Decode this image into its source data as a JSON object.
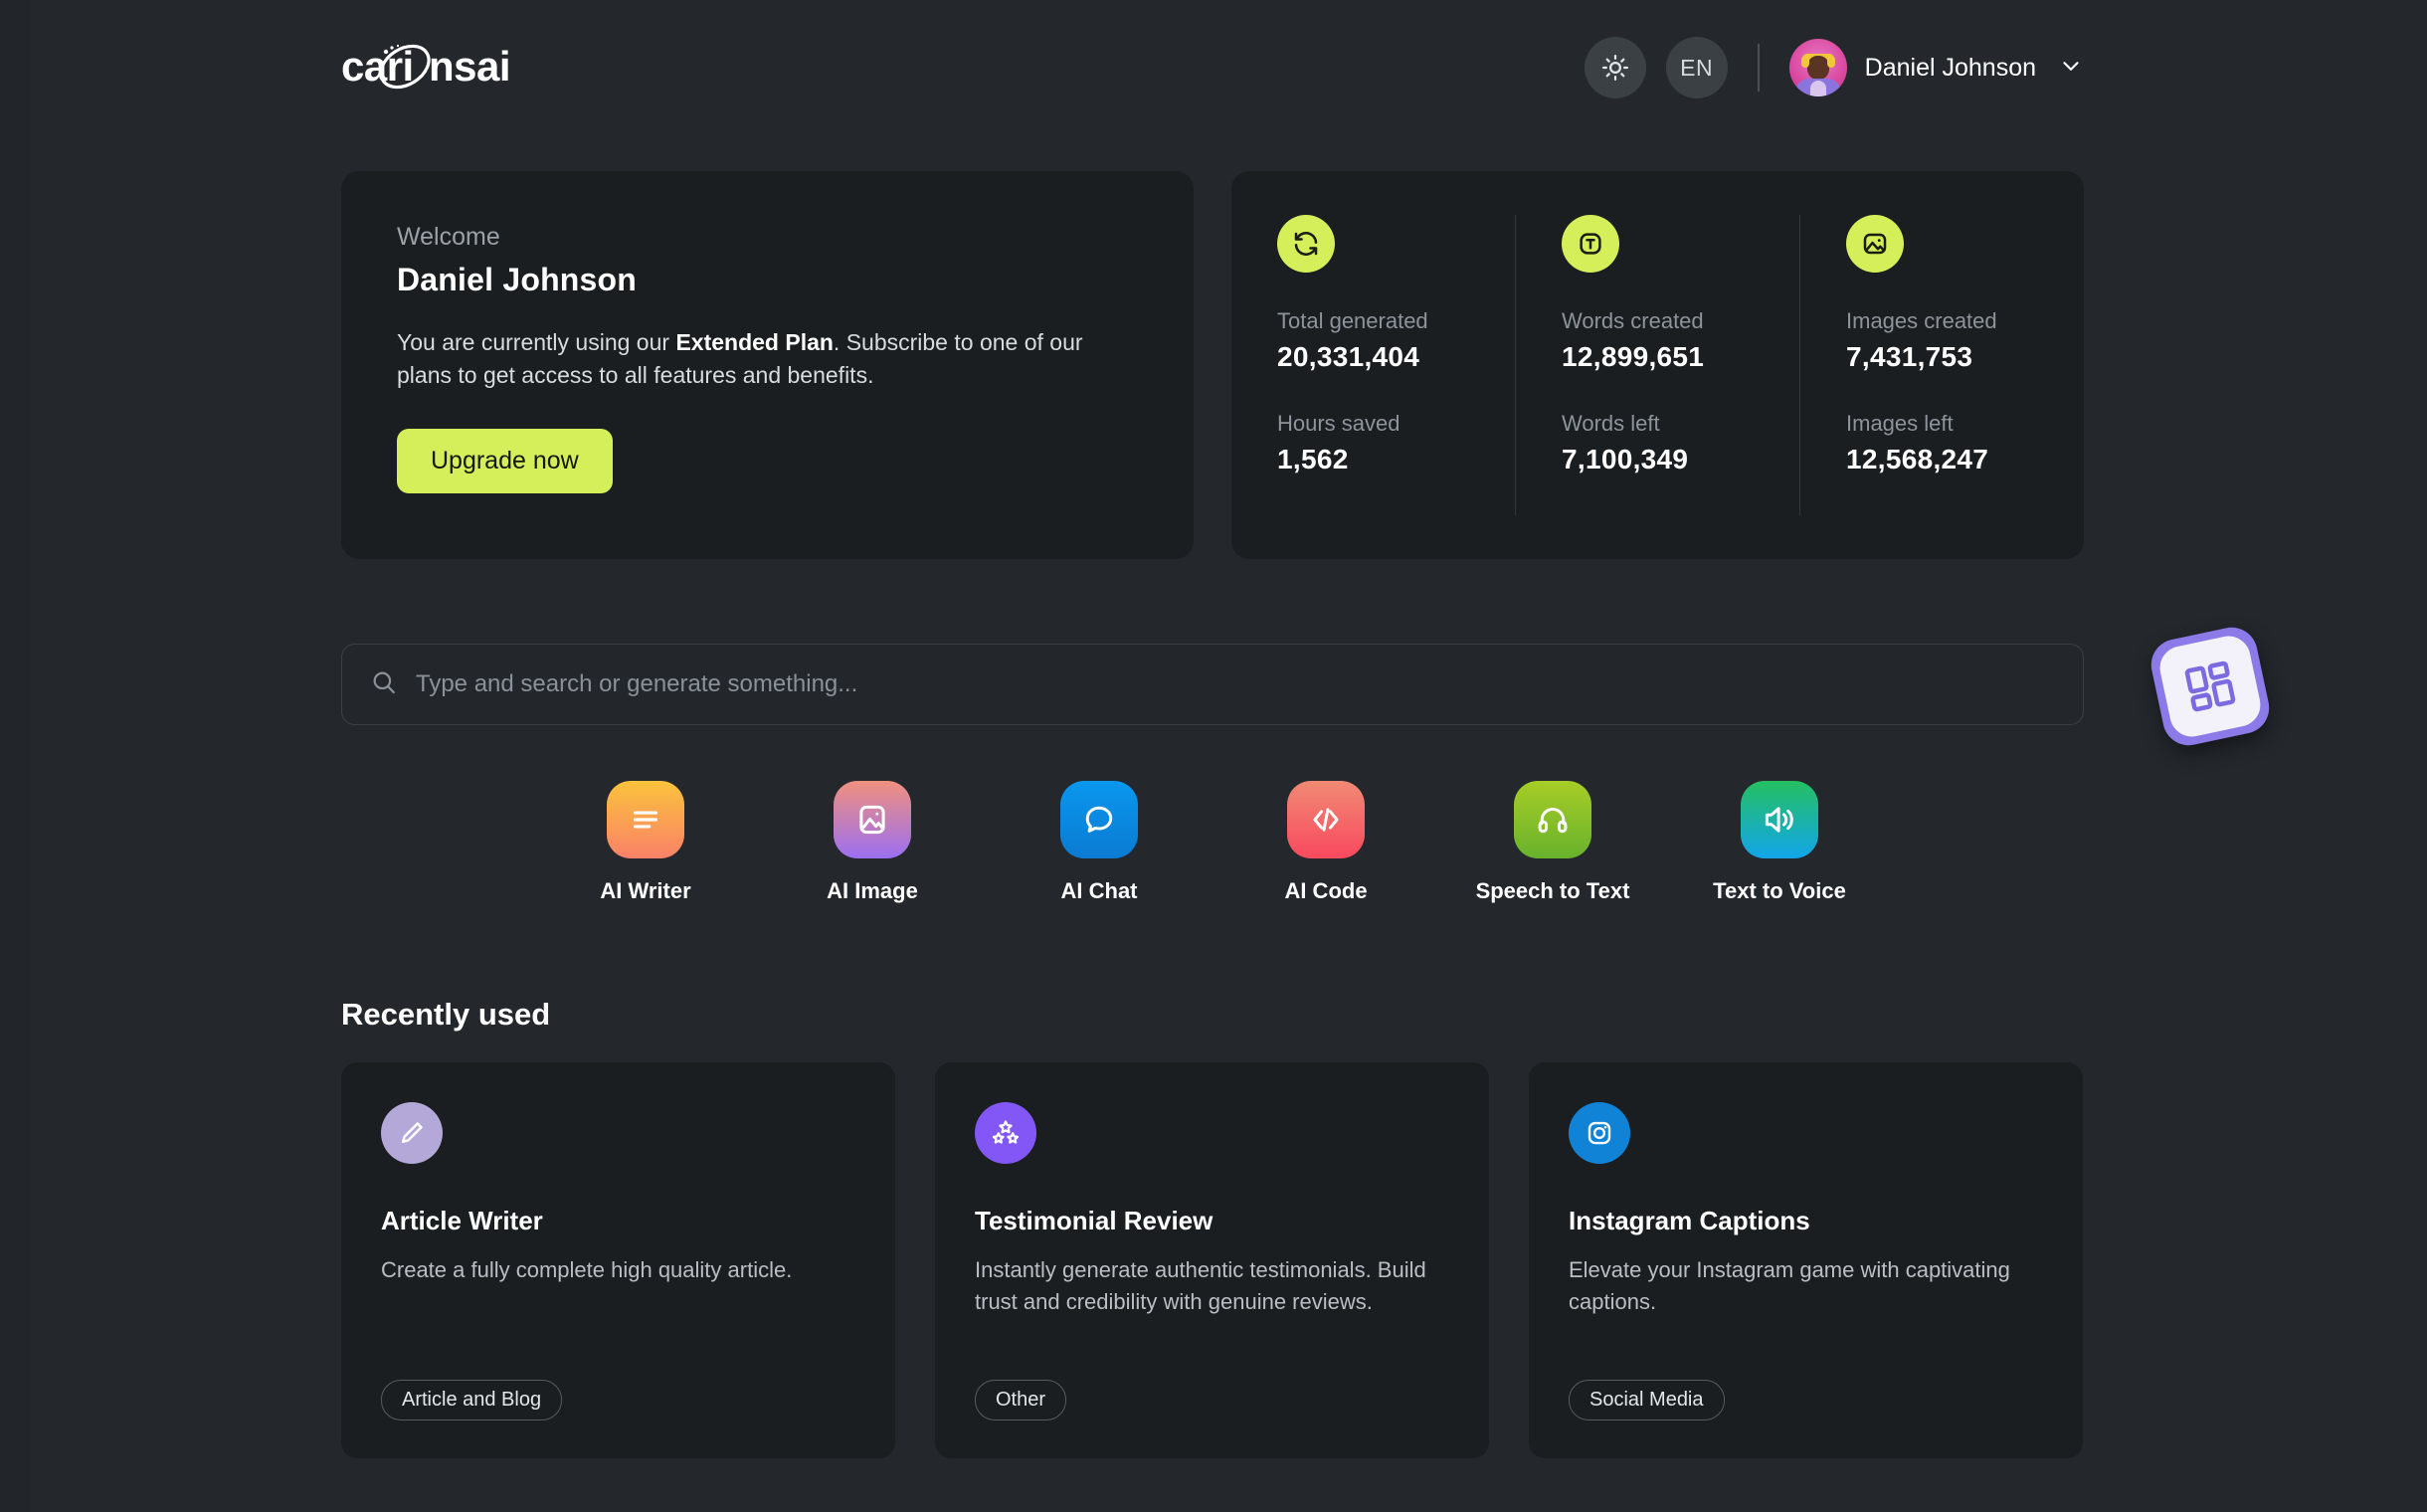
{
  "brand": {
    "name": "carionsai"
  },
  "header": {
    "theme_toggle_icon": "sun-icon",
    "language": "EN",
    "user_name": "Daniel Johnson",
    "chevron_icon": "chevron-down-icon"
  },
  "welcome": {
    "greeting": "Welcome",
    "name": "Daniel Johnson",
    "desc_before": "You are currently using our ",
    "plan": "Extended Plan",
    "desc_after": ". Subscribe to one of our plans to get access to all features and benefits.",
    "upgrade_label": "Upgrade now"
  },
  "stats": {
    "columns": [
      {
        "icon": "refresh-icon",
        "top_label": "Total generated",
        "top_value": "20,331,404",
        "bottom_label": "Hours saved",
        "bottom_value": "1,562"
      },
      {
        "icon": "text-box-icon",
        "top_label": "Words created",
        "top_value": "12,899,651",
        "bottom_label": "Words left",
        "bottom_value": "7,100,349"
      },
      {
        "icon": "image-icon",
        "top_label": "Images created",
        "top_value": "7,431,753",
        "bottom_label": "Images left",
        "bottom_value": "12,568,247"
      }
    ]
  },
  "search": {
    "icon": "search-icon",
    "placeholder": "Type and search or generate something...",
    "value": ""
  },
  "apps_fab": {
    "icon": "grid-apps-icon"
  },
  "tools": [
    {
      "label": "AI Writer",
      "icon": "lines-icon",
      "c1": "#fbc33c",
      "c2": "#f98168"
    },
    {
      "label": "AI Image",
      "icon": "image-icon",
      "c1": "#f0907e",
      "c2": "#9b6ff0"
    },
    {
      "label": "AI Chat",
      "icon": "chat-bubble-icon",
      "c1": "#0a92e8",
      "c2": "#0a7fd6"
    },
    {
      "label": "AI Code",
      "icon": "code-icon",
      "c1": "#f0806e",
      "c2": "#f94b5e"
    },
    {
      "label": "Speech to Text",
      "icon": "headphones-icon",
      "c1": "#9dc82a",
      "c2": "#6fb52a"
    },
    {
      "label": "Text to Voice",
      "icon": "speaker-icon",
      "c1": "#24bf62",
      "c2": "#13a5e8"
    }
  ],
  "recent": {
    "title": "Recently used",
    "cards": [
      {
        "icon": "pencil-icon",
        "icon_bg": "#b3a8d8",
        "title": "Article Writer",
        "desc": "Create a fully complete high quality article.",
        "tag": "Article and Blog"
      },
      {
        "icon": "stars-icon",
        "icon_bg": "#8257f5",
        "title": "Testimonial Review",
        "desc": "Instantly generate authentic testimonials. Build trust and credibility with genuine reviews.",
        "tag": "Other"
      },
      {
        "icon": "instagram-icon",
        "icon_bg": "#1183d6",
        "title": "Instagram Captions",
        "desc": "Elevate your Instagram game with captivating captions.",
        "tag": "Social Media"
      }
    ]
  },
  "colors": {
    "page_bg": "#24282d",
    "card_bg": "#1b1e21",
    "accent": "#d4ef59",
    "fab": "#8b7ae8"
  }
}
